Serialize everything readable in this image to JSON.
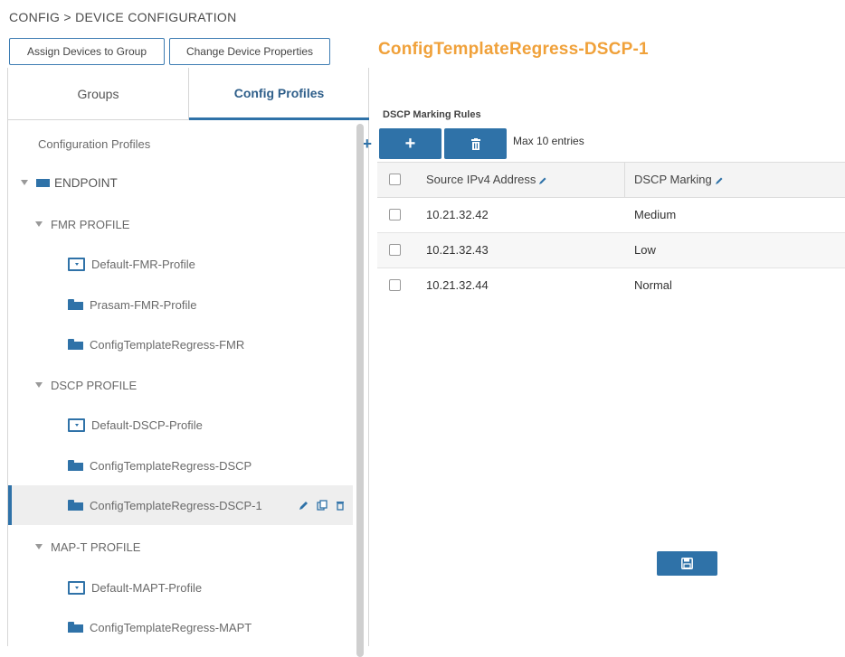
{
  "breadcrumb": "CONFIG > DEVICE CONFIGURATION",
  "toolbar": {
    "assign_label": "Assign Devices to Group",
    "change_label": "Change Device Properties"
  },
  "page_title": "ConfigTemplateRegress-DSCP-1",
  "tabs": {
    "groups": "Groups",
    "config_profiles": "Config Profiles",
    "active": "Config Profiles"
  },
  "tree": {
    "header": "Configuration Profiles",
    "root": "ENDPOINT",
    "fmr_group": "FMR PROFILE",
    "fmr_items": [
      "Default-FMR-Profile",
      "Prasam-FMR-Profile",
      "ConfigTemplateRegress-FMR"
    ],
    "dscp_group": "DSCP PROFILE",
    "dscp_items": [
      "Default-DSCP-Profile",
      "ConfigTemplateRegress-DSCP",
      "ConfigTemplateRegress-DSCP-1"
    ],
    "mapt_group": "MAP-T PROFILE",
    "mapt_items": [
      "Default-MAPT-Profile",
      "ConfigTemplateRegress-MAPT"
    ],
    "selected": "ConfigTemplateRegress-DSCP-1"
  },
  "rules": {
    "section_title": "DSCP Marking Rules",
    "max_entries": "Max 10 entries",
    "columns": [
      "Source IPv4 Address",
      "DSCP Marking"
    ],
    "rows": [
      {
        "source": "10.21.32.42",
        "marking": "Medium"
      },
      {
        "source": "10.21.32.43",
        "marking": "Low"
      },
      {
        "source": "10.21.32.44",
        "marking": "Normal"
      }
    ]
  },
  "colors": {
    "accent": "#2f72a8",
    "title": "#f0a13a"
  },
  "icons": {
    "add": "plus-icon",
    "delete": "trash-icon",
    "save": "floppy-disk-icon",
    "edit": "pencil-icon",
    "copy": "copy-icon"
  }
}
